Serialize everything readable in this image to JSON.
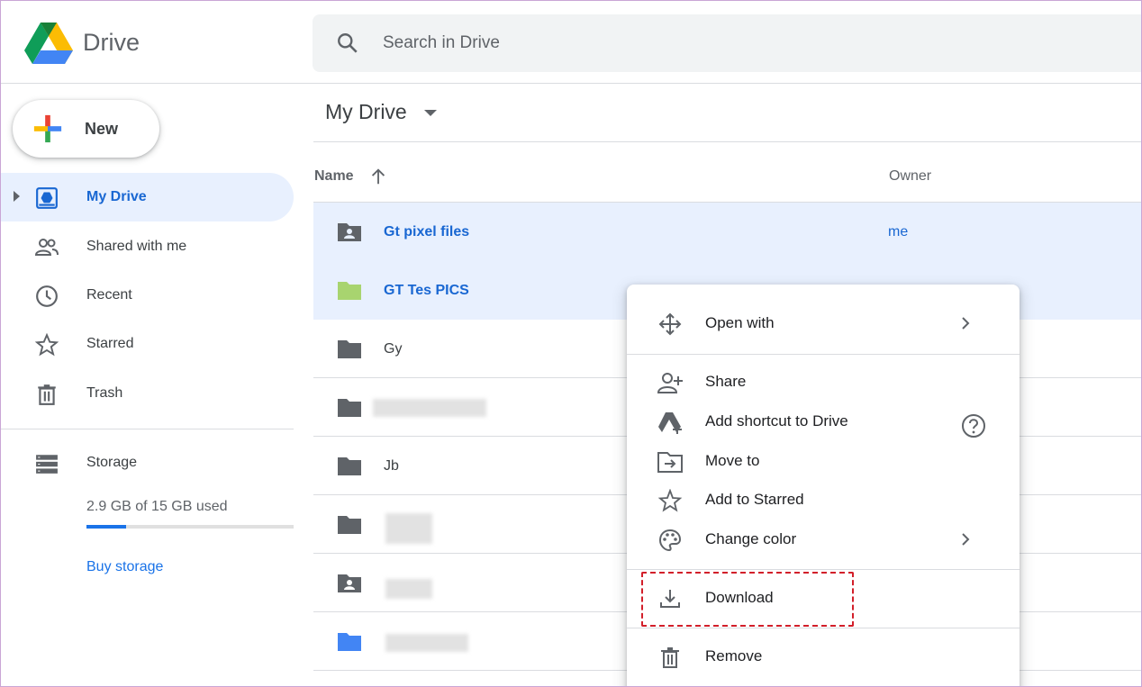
{
  "header": {
    "brand": "Drive",
    "search_placeholder": "Search in Drive"
  },
  "sidebar": {
    "new_label": "New",
    "items": [
      {
        "label": "My Drive",
        "icon": "my-drive-icon",
        "active": true
      },
      {
        "label": "Shared with me",
        "icon": "people-icon"
      },
      {
        "label": "Recent",
        "icon": "clock-icon"
      },
      {
        "label": "Starred",
        "icon": "star-icon"
      },
      {
        "label": "Trash",
        "icon": "trash-icon"
      }
    ],
    "storage": {
      "label": "Storage",
      "used_text": "2.9 GB of 15 GB used",
      "used_fraction": 0.19,
      "buy_label": "Buy storage"
    }
  },
  "main": {
    "breadcrumb": "My Drive",
    "columns": {
      "name": "Name",
      "owner": "Owner"
    },
    "rows": [
      {
        "name": "Gt pixel files",
        "owner": "me",
        "icon": "shared-folder-icon",
        "selected": true
      },
      {
        "name": "GT Tes PICS",
        "owner": "",
        "icon": "folder-icon",
        "selected": true
      },
      {
        "name": "Gy",
        "owner": "",
        "icon": "folder-icon"
      },
      {
        "name": "",
        "owner": "",
        "icon": "folder-icon"
      },
      {
        "name": "Jb",
        "owner": "",
        "icon": "folder-icon"
      },
      {
        "name": "",
        "owner": "",
        "icon": "folder-icon"
      },
      {
        "name": "",
        "owner": "",
        "icon": "shared-folder-icon"
      },
      {
        "name": "",
        "owner": "",
        "icon": "folder-icon"
      }
    ]
  },
  "context_menu": {
    "items": [
      {
        "label": "Open with",
        "icon": "move-arrows-icon",
        "submenu": true
      },
      {
        "label": "Share",
        "icon": "person-add-icon"
      },
      {
        "label": "Add shortcut to Drive",
        "icon": "drive-shortcut-icon"
      },
      {
        "label": "Move to",
        "icon": "folder-move-icon"
      },
      {
        "label": "Add to Starred",
        "icon": "star-icon"
      },
      {
        "label": "Change color",
        "icon": "palette-icon",
        "submenu": true
      },
      {
        "label": "Download",
        "icon": "download-icon",
        "highlighted": true
      },
      {
        "label": "Remove",
        "icon": "trash-icon"
      }
    ]
  },
  "colors": {
    "accent": "#1a73e8",
    "selected_bg": "#e8f0fe",
    "highlight_border": "#d21f2a",
    "folder_green": "#a8d46f",
    "folder_blue": "#4285f4",
    "folder_grey": "#5f6368"
  }
}
